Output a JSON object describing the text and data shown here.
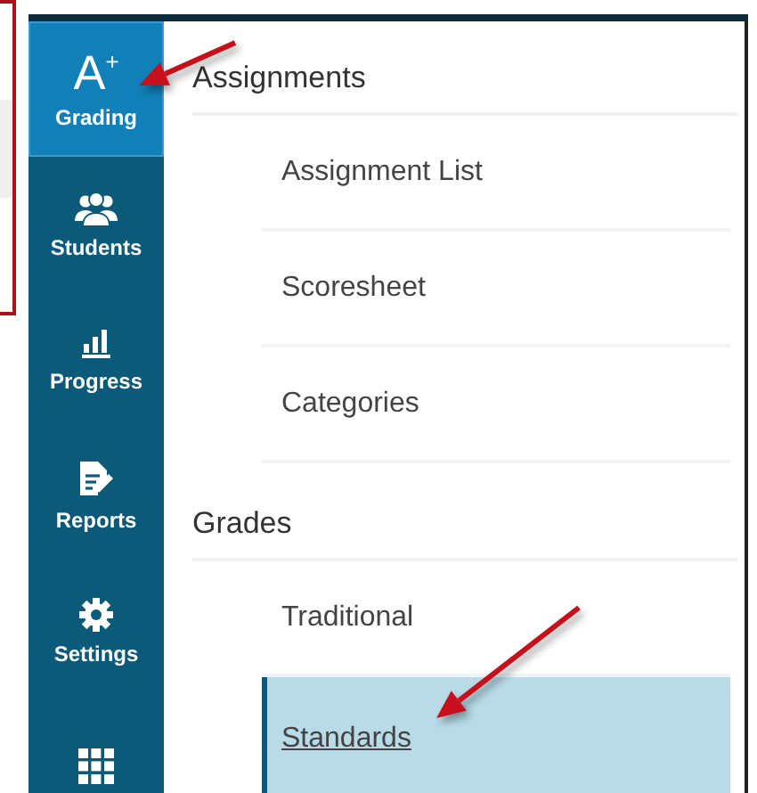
{
  "sidebar": {
    "items": [
      {
        "kind": "grading",
        "icon_text": "A$^{+}$",
        "label": "Grading",
        "selected": true,
        "pointed": true
      },
      {
        "kind": "students",
        "label": "Students",
        "selected": false,
        "pointed": false
      },
      {
        "kind": "progress",
        "label": "Progress",
        "selected": false,
        "pointed": false
      },
      {
        "kind": "reports",
        "label": "Reports",
        "selected": false,
        "pointed": false
      },
      {
        "kind": "settings",
        "label": "Settings",
        "selected": false,
        "pointed": false
      },
      {
        "kind": "apps",
        "selected": false,
        "pointed": false
      }
    ]
  },
  "menu": {
    "sections": [
      {
        "header": "Assignments",
        "items": [
          {
            "label": "Assignment List",
            "selected": false,
            "pointed": false
          },
          {
            "label": "Scoresheet",
            "selected": false,
            "pointed": false
          },
          {
            "label": "Categories",
            "selected": false,
            "pointed": false
          }
        ]
      },
      {
        "header": "Grades",
        "items": [
          {
            "label": "Traditional",
            "selected": false,
            "pointed": false
          },
          {
            "label": "Standards",
            "selected": true,
            "pointed": true
          }
        ]
      }
    ]
  }
}
